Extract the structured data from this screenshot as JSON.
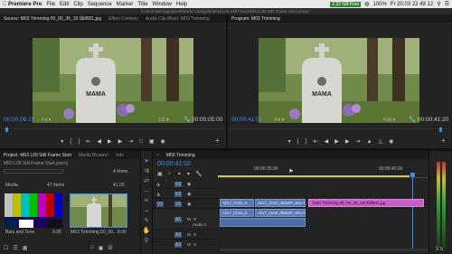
{
  "menubar": {
    "app": "Premiere Pro",
    "items": [
      "File",
      "Edit",
      "Clip",
      "Sequence",
      "Marker",
      "Title",
      "Window",
      "Help"
    ],
    "memory": "2.22 GB Free",
    "battery": "100%",
    "clock": "Fr 20.03  22 49 12"
  },
  "titlebar": {
    "path": "/Users/niversapo/pixel/Work/Autobig/ht/MO3/L09 Still Frame/M03 L09 Still Frame Start.prproj *"
  },
  "source": {
    "tabs": [
      "Source: M03 Trimming.00_00_36_19.Still001.jpg",
      "Effect Controls",
      "Audio Clip Mixer: M03 Trimming"
    ],
    "timecode": "00:00:06:19",
    "fit": "Fit",
    "fraction": "1/2",
    "duration": "00:00:05:00",
    "headstone": "MAMA"
  },
  "program": {
    "tabs": [
      "Program: M03 Trimming"
    ],
    "timecode": "00:00:41:02",
    "fit": "Fit",
    "quality": "Full",
    "duration": "00:00:41:20",
    "headstone": "MAMA"
  },
  "project": {
    "tabs": [
      "Project: M03 L09 Still Frame Start",
      "Media Browser",
      "Info"
    ],
    "file": "M03 L09 Still Frame Start.prproj",
    "items_count": "4 Items",
    "bin_label": "Media",
    "bin_count": "47 Items",
    "thumbs": [
      {
        "label": "Bars and Tone",
        "duration": "5:00"
      },
      {
        "label": "M03 Trimming.00_00...",
        "duration": "5:00"
      }
    ],
    "thumb_duration2": "41:20"
  },
  "timeline": {
    "tab": "M03 Trimming",
    "timecode": "00:00:41:02",
    "ruler": [
      "00:00:35:00",
      "00:00:40:00"
    ],
    "tracks": [
      {
        "id": "V3",
        "label": "V3"
      },
      {
        "id": "V2",
        "label": "V2"
      },
      {
        "id": "V1",
        "label": "V1"
      },
      {
        "id": "A1",
        "label": "A1",
        "name": "Audio 1"
      },
      {
        "id": "A2",
        "label": "A2"
      },
      {
        "id": "A3",
        "label": "A3"
      }
    ],
    "clips_video": [
      "A017_C024_0...",
      "A017_C024_08250P_001.mp4",
      "A017_C026_08250P_001.mp4"
    ],
    "still_clip": "M03 Trimming.00_00_36_19.Still001.jpg"
  },
  "colors": {
    "accent_blue": "#3d8eea",
    "clip_pink": "#c660c8",
    "clip_blue": "#5a78b0",
    "playhead": "#3d8eea"
  }
}
